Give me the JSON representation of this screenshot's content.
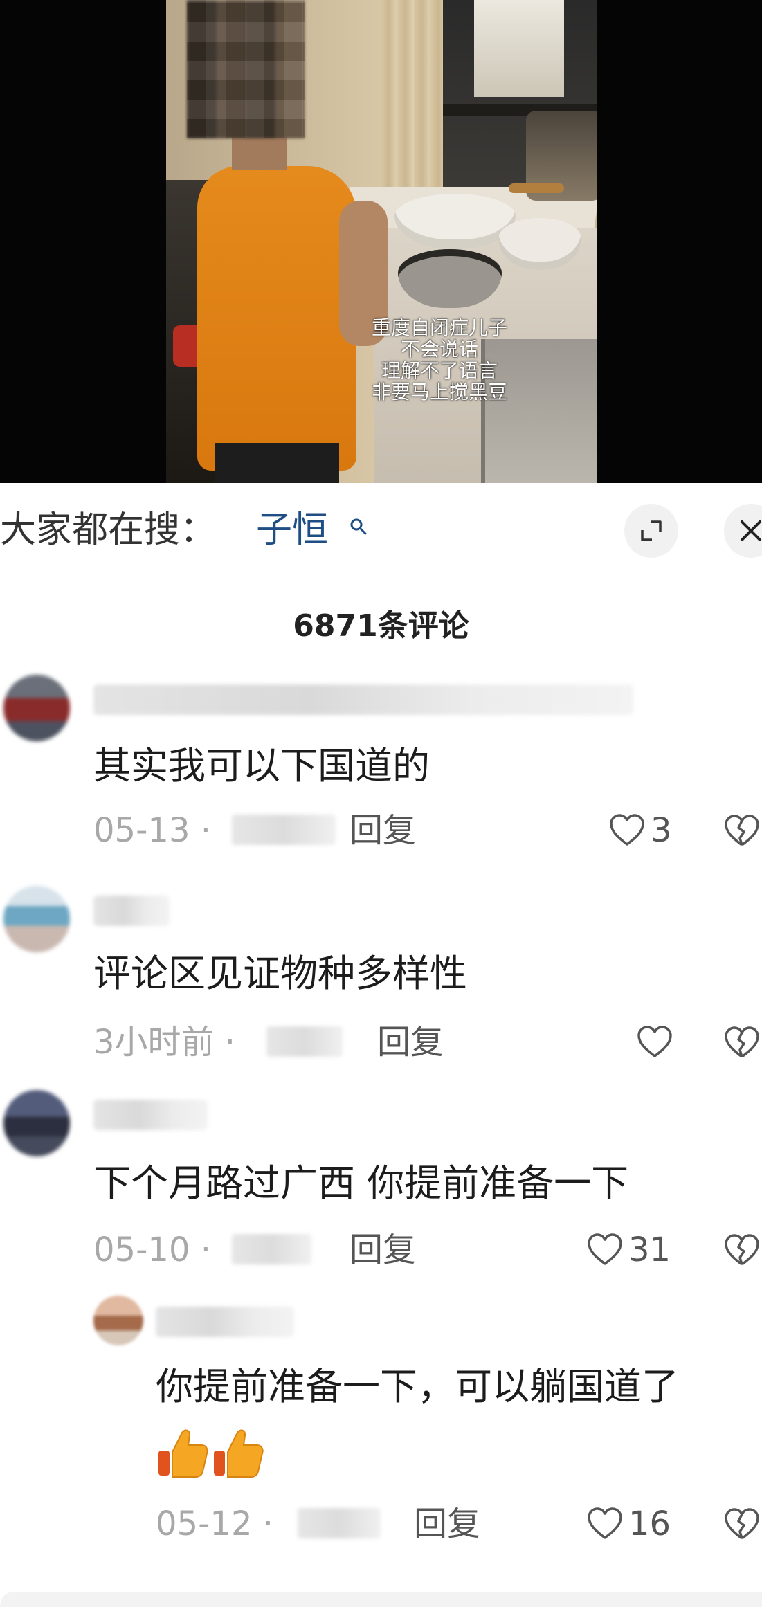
{
  "video": {
    "caption_lines": [
      "重度自闭症儿子",
      "不会说话",
      "理解不了语言",
      "非要马上搅黑豆"
    ]
  },
  "search": {
    "prefix": "大家都在搜：",
    "keyword": "子恒"
  },
  "comments_header": {
    "count_label": "6871条评论"
  },
  "comments": [
    {
      "text": "其实我可以下国道的",
      "date": "05-13 ·",
      "reply": "回复",
      "likes": "3"
    },
    {
      "text": "评论区见证物种多样性",
      "date": "3小时前 ·",
      "reply": "回复",
      "likes": ""
    },
    {
      "text": "下个月路过广西 你提前准备一下",
      "date": "05-10 ·",
      "reply": "回复",
      "likes": "31"
    },
    {
      "text": "你提前准备一下，可以躺国道了",
      "date": "05-12 ·",
      "reply": "回复",
      "likes": "16"
    }
  ],
  "colors": {
    "keyword": "#1f4e85",
    "meta": "#a8a8a8",
    "thumb_emoji": "#f5a623"
  },
  "icons": [
    "search-icon",
    "expand-icon",
    "close-icon",
    "heart-icon",
    "broken-heart-icon",
    "thumbs-up-emoji"
  ]
}
